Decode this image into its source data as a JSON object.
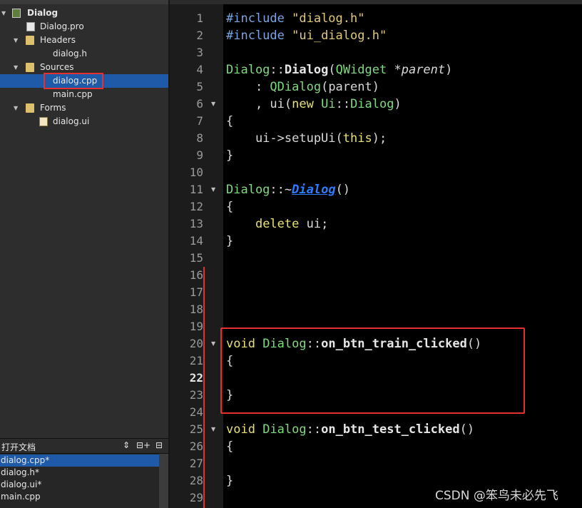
{
  "tree": {
    "items": [
      {
        "label": "Dialog",
        "arrow": "▼"
      },
      {
        "label": "Dialog.pro"
      },
      {
        "label": "Headers",
        "arrow": "▼"
      },
      {
        "label": "dialog.h"
      },
      {
        "label": "Sources",
        "arrow": "▼"
      },
      {
        "label": "dialog.cpp"
      },
      {
        "label": "main.cpp"
      },
      {
        "label": "Forms",
        "arrow": "▼"
      },
      {
        "label": "dialog.ui"
      }
    ]
  },
  "open_docs": {
    "title": "打开文档",
    "sort_icon": "⇕",
    "split_icon": "⊟+",
    "close_icon": "⊟",
    "items": [
      "dialog.cpp*",
      "dialog.h*",
      "dialog.ui*",
      "main.cpp"
    ]
  },
  "line_numbers": [
    "1",
    "2",
    "3",
    "4",
    "5",
    "6",
    "7",
    "8",
    "9",
    "10",
    "11",
    "12",
    "13",
    "14",
    "15",
    "16",
    "17",
    "18",
    "19",
    "20",
    "21",
    "22",
    "23",
    "24",
    "25",
    "26",
    "27",
    "28",
    "29"
  ],
  "fold_marker": "▼",
  "watermark": "CSDN @笨鸟未必先飞",
  "colors": {
    "selection": "#1e5aa8",
    "annotation_red": "#e53030",
    "keyword": "#e8e070",
    "type": "#7fd97f",
    "preprocessor": "#7aa7e0",
    "string": "#e0c97a"
  }
}
